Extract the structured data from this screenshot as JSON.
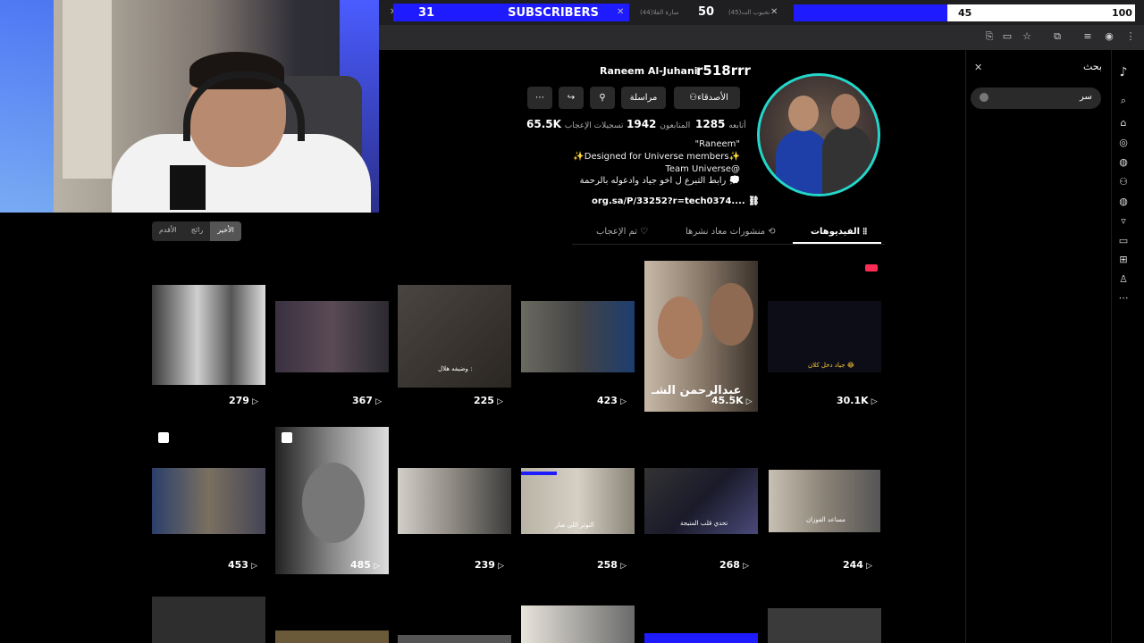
{
  "stream": {
    "subscriber_count": "31",
    "subscriber_label": "SUBSCRIBERS",
    "tab_count": "50",
    "goal_current": "45",
    "goal_target": "100",
    "tab_texts": [
      "(44)سارة القلا",
      "(45)نحبوب الت"
    ]
  },
  "sort_tabs": [
    "الأقدم",
    "رائج",
    "الأخير"
  ],
  "search": {
    "title": "بحث",
    "value": "سر"
  },
  "profile": {
    "username": "r518rrr",
    "display_name": "Raneem Al-Juhani",
    "buttons": {
      "friends": "الأصدقاء",
      "message": "مراسلة"
    },
    "stats": {
      "following_value": "1285",
      "following_label": "أتابعه",
      "followers_value": "1942",
      "followers_label": "المتابعون",
      "likes_value": "65.5K",
      "likes_label": "تسجيلات الإعجاب"
    },
    "bio": [
      "\"Raneem\"",
      "✨Designed for Universe members✨",
      "Team Universe@",
      "رابط التبرع ل اخو جياد وادعوله بالرحمة 💭"
    ],
    "link": "org.sa/P/33252?r=tech0374...."
  },
  "content_tabs": {
    "videos": "الفيديوهات",
    "reposts": "منشورات معاد نشرها",
    "liked": "تم الإعجاب"
  },
  "videos_row1": [
    {
      "views": "30.1K",
      "caption": "جياد دخل كلان 😂"
    },
    {
      "views": "45.5K",
      "caption": "عبدالرحمن الشـ"
    },
    {
      "views": "423",
      "caption": ""
    },
    {
      "views": "225",
      "caption": "وضيفه هلال :"
    },
    {
      "views": "367",
      "caption": ""
    },
    {
      "views": "279",
      "caption": ""
    }
  ],
  "videos_row2": [
    {
      "views": "244",
      "caption": "مساعد الفوزان"
    },
    {
      "views": "268",
      "caption": "تحدي قلب المتيجة"
    },
    {
      "views": "258",
      "caption": "النوتر اللي صار"
    },
    {
      "views": "239",
      "caption": ""
    },
    {
      "views": "485",
      "caption": ""
    },
    {
      "views": "453",
      "caption": ""
    }
  ],
  "colors": {
    "accent_blue": "#1e1bff",
    "avatar_ring": "#24d6c9",
    "tiktok_red": "#fe2c55"
  }
}
